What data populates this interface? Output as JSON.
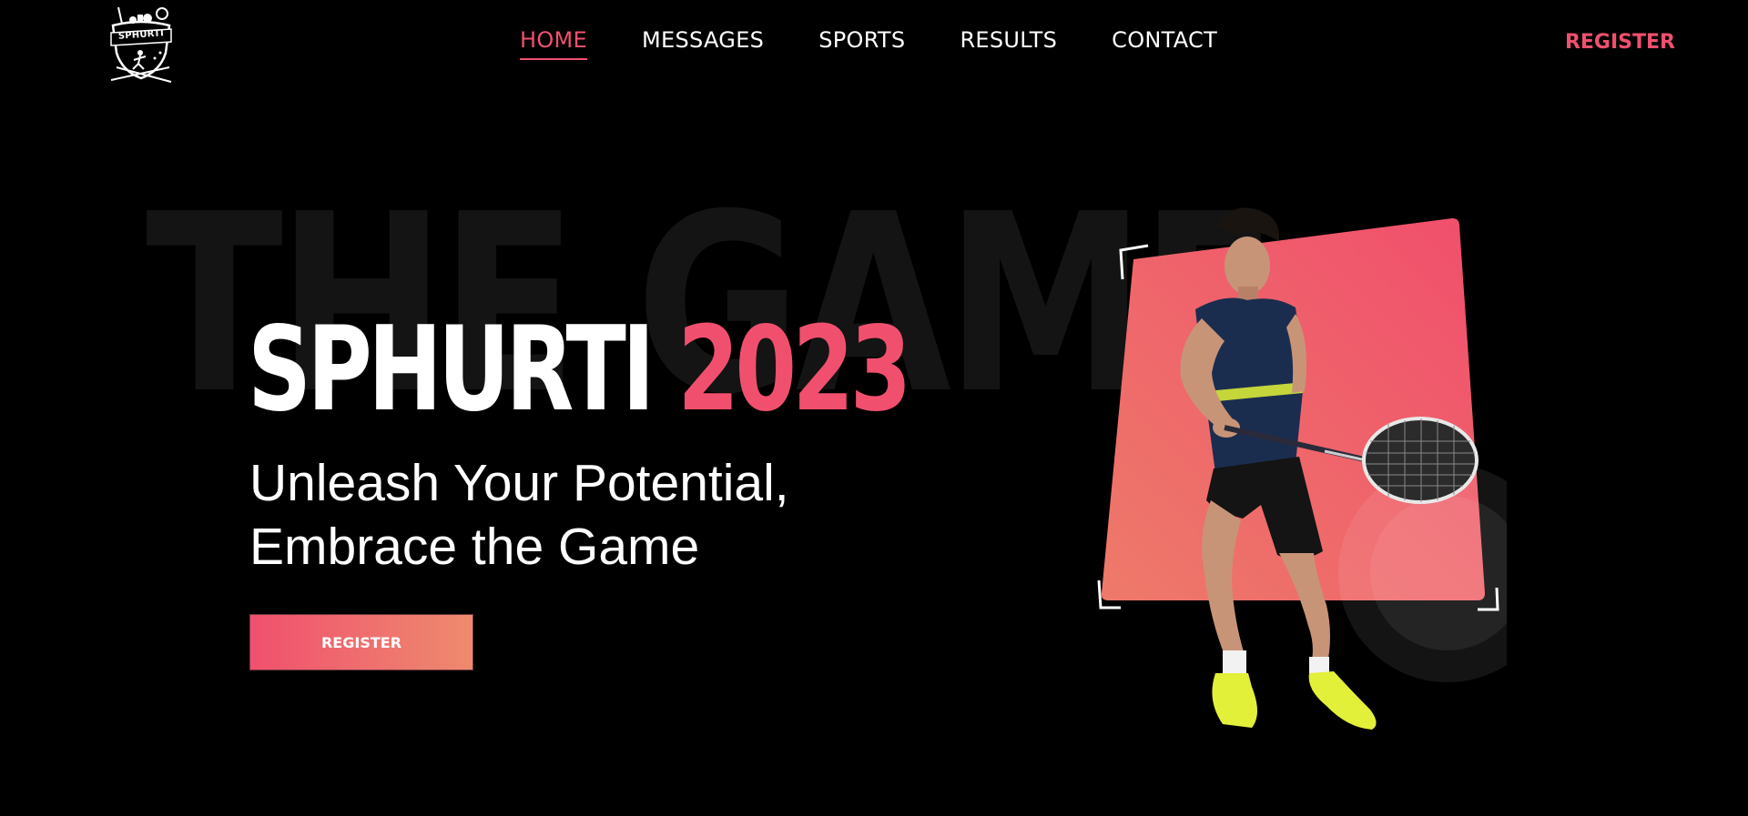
{
  "logo": {
    "text": "SPHURTI",
    "icon": "sports-shield-logo"
  },
  "nav": {
    "items": [
      {
        "label": "HOME",
        "active": true
      },
      {
        "label": "MESSAGES",
        "active": false
      },
      {
        "label": "SPORTS",
        "active": false
      },
      {
        "label": "RESULTS",
        "active": false
      },
      {
        "label": "CONTACT",
        "active": false
      }
    ],
    "register_label": "REGISTER"
  },
  "hero": {
    "background_word": "THE GAME",
    "title_main": "SPHURTI",
    "title_year": "2023",
    "subtitle_line1": "Unleash Your Potential,",
    "subtitle_line2": "Embrace the Game",
    "register_button": "REGISTER",
    "image_icon": "badminton-player-image"
  },
  "colors": {
    "background": "#000000",
    "accent": "#f0506e",
    "accent_gradient_end": "#ee8b6e",
    "text": "#ffffff",
    "background_word": "#141414"
  }
}
